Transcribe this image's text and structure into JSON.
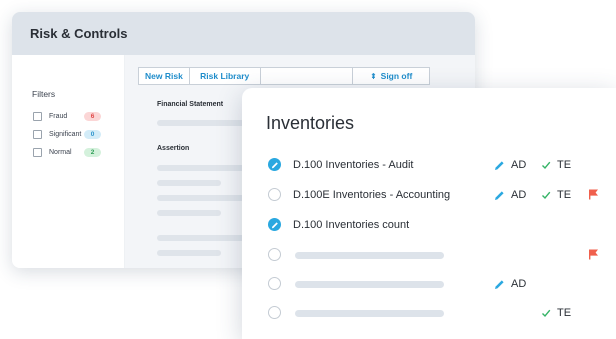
{
  "back_panel": {
    "title": "Risk & Controls",
    "filters": {
      "heading": "Filters",
      "items": [
        {
          "label": "Fraud",
          "count": "6",
          "bg": "#fbd6d6",
          "fg": "#e04848"
        },
        {
          "label": "Significant",
          "count": "0",
          "bg": "#d3ecf8",
          "fg": "#2b93cc"
        },
        {
          "label": "Normal",
          "count": "2",
          "bg": "#d4f1dc",
          "fg": "#2e9e57"
        }
      ]
    },
    "tabs": {
      "new_risk": "New Risk",
      "risk_library": "Risk Library",
      "sign_off_icon": "⇞",
      "sign_off": "Sign off"
    },
    "sections": {
      "financial_statement": "Financial Statement",
      "assertion": "Assertion"
    }
  },
  "front_panel": {
    "title": "Inventories",
    "items": [
      {
        "label": "D.100 Inventories - Audit",
        "checked": true,
        "ad": "AD",
        "te": "TE",
        "flag": false
      },
      {
        "label": "D.100E Inventories - Accounting",
        "checked": false,
        "ad": "AD",
        "te": "TE",
        "flag": true
      },
      {
        "label": "D.100 Inventories count",
        "checked": true,
        "ad": null,
        "te": null,
        "flag": false
      },
      {
        "label": null,
        "checked": false,
        "ad": null,
        "te": null,
        "flag": true
      },
      {
        "label": null,
        "checked": false,
        "ad": "AD",
        "te": null,
        "flag": false
      },
      {
        "label": null,
        "checked": false,
        "ad": null,
        "te": "TE",
        "flag": false
      }
    ]
  },
  "colors": {
    "accent": "#2aa8e0",
    "link": "#1f8dcb",
    "check_green": "#35b366",
    "flag_red": "#f0604d"
  },
  "icons": [
    "check-circle-icon",
    "empty-circle-icon",
    "pencil-icon",
    "checkmark-icon",
    "flag-icon",
    "checkbox-icon"
  ]
}
